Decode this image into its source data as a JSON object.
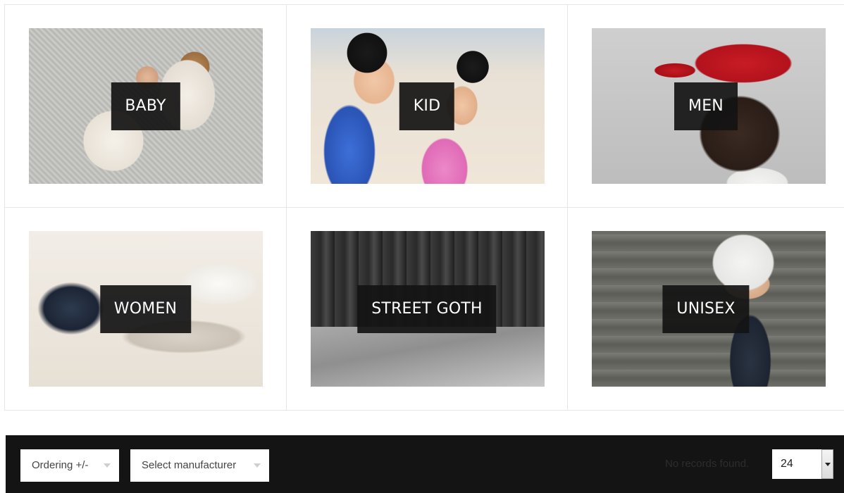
{
  "categories": [
    {
      "label": "BABY",
      "image": "baby-photo"
    },
    {
      "label": "KID",
      "image": "kid-photo"
    },
    {
      "label": "MEN",
      "image": "men-photo"
    },
    {
      "label": "WOMEN",
      "image": "women-photo"
    },
    {
      "label": "STREET GOTH",
      "image": "street-goth-photo"
    },
    {
      "label": "UNISEX",
      "image": "unisex-photo"
    }
  ],
  "toolbar": {
    "ordering": "Ordering +/-",
    "manufacturer": "Select manufacturer",
    "no_records": "No records found.",
    "per_page": "24"
  }
}
